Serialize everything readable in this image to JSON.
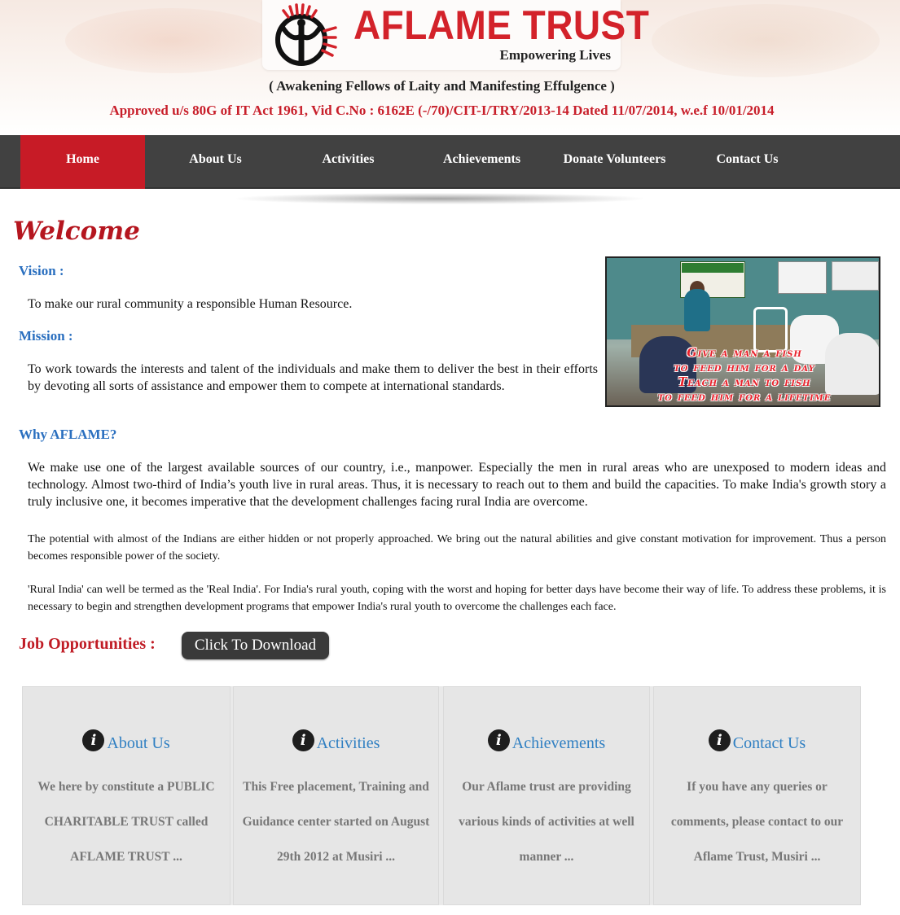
{
  "header": {
    "logo_title": "AFLAME TRUST",
    "logo_tagline": "Empowering Lives",
    "subtitle": "( Awakening Fellows of Laity and Manifesting Effulgence )",
    "approval": "Approved u/s 80G of IT Act 1961, Vid C.No : 6162E (-/70)/CIT-I/TRY/2013-14 Dated 11/07/2014, w.e.f 10/01/2014"
  },
  "nav": {
    "items": [
      {
        "label": "Home",
        "active": true
      },
      {
        "label": "About Us"
      },
      {
        "label": "Activities"
      },
      {
        "label": "Achievements"
      },
      {
        "label": "Donate Volunteers"
      },
      {
        "label": "Contact Us"
      }
    ]
  },
  "main": {
    "welcome": "Welcome",
    "vision_heading": "Vision :",
    "vision_text": "To make our rural community a responsible Human Resource.",
    "mission_heading": "Mission :",
    "mission_text": "To work towards the interests and talent of the individuals and make them to deliver the best in their efforts by devoting all sorts of assistance and empower them to compete at international standards.",
    "why_heading": "Why AFLAME?",
    "why_text_1": "We make use one of the largest available sources of our country, i.e., manpower. Especially the men in rural areas who are unexposed to modern ideas and technology. Almost two-third of India’s youth live in rural areas. Thus, it is necessary to reach out to them and build the capacities. To make India's growth story a truly inclusive one, it becomes imperative that the development challenges facing rural India are overcome.",
    "why_text_2": "The potential with almost of the Indians are either hidden or not properly approached. We bring out the natural abilities and give constant motivation for improvement. Thus a person becomes responsible power of the society.",
    "why_text_3": "'Rural India' can well be termed as the 'Real India'. For India's rural youth, coping with the worst and hoping for better days have become their way of life. To address these problems, it is necessary to begin and strengthen development programs that empower India's rural youth to overcome the challenges each face.",
    "photo_caption": [
      "Give a man a fish",
      "to feed  him for a day",
      "Teach a man to fish",
      "to feed him for a lifetime"
    ],
    "job_label": "Job Opportunities :",
    "download_button": "Click To Download"
  },
  "boxes": [
    {
      "icon": "info-icon",
      "title": "About Us",
      "text": "We here by constitute a PUBLIC CHARITABLE TRUST called AFLAME TRUST ..."
    },
    {
      "icon": "info-icon",
      "title": "Activities",
      "text": "This Free placement, Training and Guidance center started on August 29th 2012 at Musiri ..."
    },
    {
      "icon": "info-icon",
      "title": "Achievements",
      "text": "Our Aflame trust are providing various kinds of activities at well manner ..."
    },
    {
      "icon": "info-icon",
      "title": "Contact Us",
      "text": "If you have any queries or comments, please contact to our Aflame Trust, Musiri ..."
    }
  ],
  "colors": {
    "brand_red": "#c71b26",
    "nav_bg": "#414141",
    "heading_blue": "#2a6fbf",
    "link_blue": "#2f7fc2"
  }
}
